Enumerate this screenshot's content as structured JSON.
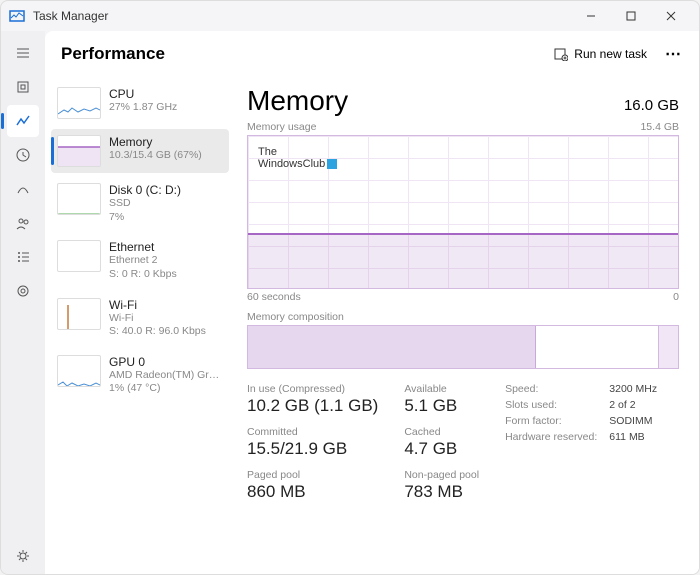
{
  "window": {
    "title": "Task Manager"
  },
  "header": {
    "title": "Performance",
    "run_task": "Run new task"
  },
  "sidebar": {
    "items": [
      {
        "label": "CPU",
        "sub1": "27% 1.87 GHz"
      },
      {
        "label": "Memory",
        "sub1": "10.3/15.4 GB (67%)"
      },
      {
        "label": "Disk 0 (C: D:)",
        "sub1": "SSD",
        "sub2": "7%"
      },
      {
        "label": "Ethernet",
        "sub1": "Ethernet 2",
        "sub2": "S: 0 R: 0 Kbps"
      },
      {
        "label": "Wi-Fi",
        "sub1": "Wi-Fi",
        "sub2": "S: 40.0 R: 96.0 Kbps"
      },
      {
        "label": "GPU 0",
        "sub1": "AMD Radeon(TM) Gra...",
        "sub2": "1% (47 °C)"
      }
    ]
  },
  "detail": {
    "title": "Memory",
    "total": "16.0 GB",
    "usage_label": "Memory usage",
    "usage_max": "15.4 GB",
    "axis_left": "60 seconds",
    "axis_right": "0",
    "comp_label": "Memory composition",
    "watermark_line1": "The",
    "watermark_line2": "WindowsClub"
  },
  "stats": {
    "in_use_lbl": "In use (Compressed)",
    "in_use": "10.2 GB (1.1 GB)",
    "committed_lbl": "Committed",
    "committed": "15.5/21.9 GB",
    "paged_lbl": "Paged pool",
    "paged": "860 MB",
    "available_lbl": "Available",
    "available": "5.1 GB",
    "cached_lbl": "Cached",
    "cached": "4.7 GB",
    "nonpaged_lbl": "Non-paged pool",
    "nonpaged": "783 MB"
  },
  "specs": {
    "speed_lbl": "Speed:",
    "speed": "3200 MHz",
    "slots_lbl": "Slots used:",
    "slots": "2 of 2",
    "form_lbl": "Form factor:",
    "form": "SODIMM",
    "reserved_lbl": "Hardware reserved:",
    "reserved": "611 MB"
  }
}
